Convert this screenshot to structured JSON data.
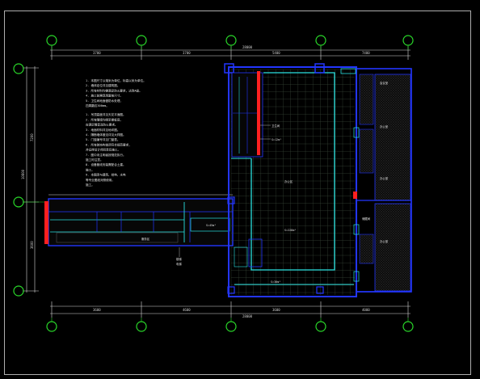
{
  "viewport": {
    "background": "#000000",
    "border": "#d9d9d9"
  },
  "colors": {
    "grid_axis": "#29d829",
    "wall": "#2336ff",
    "glass": "#29e0e0",
    "accent_red": "#ff2020",
    "dimension": "#d9d9d9",
    "tile_grid": "#3c4a3c",
    "hatch": "#5a5a5a"
  },
  "grid_axes": {
    "top_labels": [
      "",
      "",
      "",
      "",
      "",
      ""
    ],
    "bottom_labels": [
      "",
      "",
      "",
      "",
      "",
      ""
    ],
    "left_labels": [
      "",
      "",
      ""
    ]
  },
  "dimensions": {
    "top_segments": [
      "3700",
      "3700",
      "5400",
      "7400",
      "3700",
      "3700"
    ],
    "top_total": "28000",
    "bottom_segments": [
      "3600",
      "4600",
      "3600",
      "4000",
      "3600"
    ],
    "bottom_total": "28000",
    "left_segments": [
      "7200",
      "3600"
    ],
    "left_total": "10800"
  },
  "notes": {
    "lines": [
      "1. 本图尺寸以毫米为单位，标高以米为单位。",
      "2. 墙体定位详见建筑图。",
      "3. 所有材料均需满足防火要求，达到A级。",
      "4. 施工前需现场复核尺寸。",
      "5. 卫生间地面做防水处理，",
      "   四周翻边300mm。",
      "",
      "1. 吊顶高度详见天花平面图。",
      "2. 所有隔墙均砌至楼板底，",
      "   应满足隔音及防火要求。",
      "3. 地面材料详见地坪图。",
      "4. 隔断墙体做法详见大样图。",
      "5. 门窗编号详见门窗表。",
      "6. 所有装饰构造须符合规范要求，",
      "   并征得设计师同意后施工。",
      "7. 图中未注明者按规范执行。",
      "   施工时注意。",
      "8. 设备管线安装需配合土建。",
      "   施工。",
      "9. 本图须与建筑、结构、水电",
      "   等专业图纸对照使用。",
      "   施工。"
    ]
  },
  "room_labels": {
    "main_hall": "办公区",
    "main_hall_area": "S=228m²",
    "corridor": "走廊",
    "lower_room": "S=45m²",
    "bottom_strip": "S=30m²",
    "right_room_1": "会议室",
    "right_room_2": "办公室",
    "right_room_3": "办公室",
    "right_room_4": "办公室",
    "left_wing": "服务区",
    "leader_note_1": "卫生间",
    "leader_note_2": "S=12m²",
    "stair_label": "楼梯",
    "elev_label": "电梯",
    "side_note": "储藏间"
  }
}
